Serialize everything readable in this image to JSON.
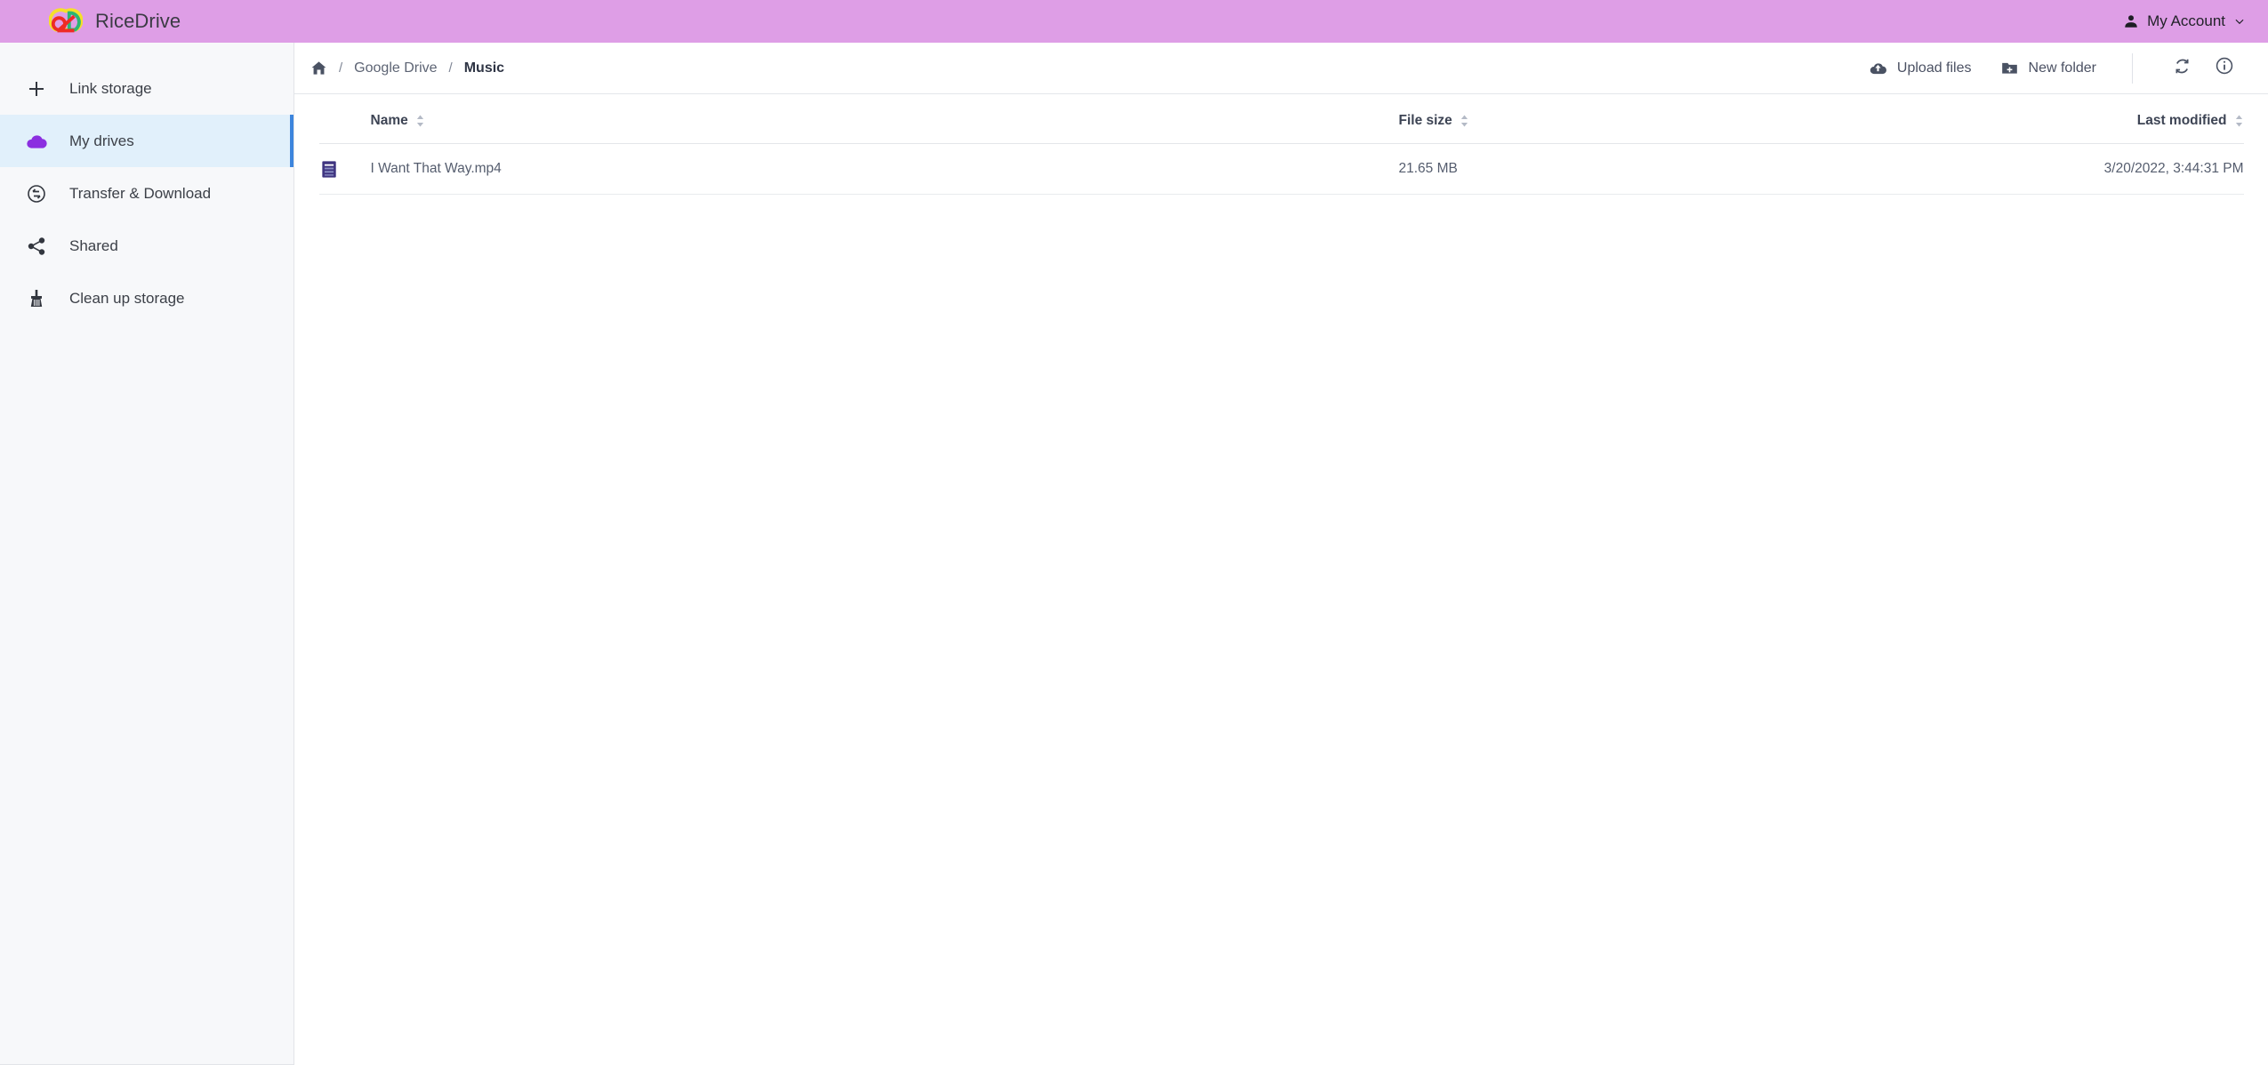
{
  "header": {
    "brand_name": "RiceDrive",
    "logo_icon": "ricedrive-logo-icon",
    "account_label": "My Account",
    "account_icon": "person-icon",
    "caret_icon": "chevron-down-icon",
    "background_color": "#de9ee6"
  },
  "sidebar": {
    "background_color": "#f7f8fa",
    "active_background_color": "#e1f0fb",
    "active_accent_color": "#3d85dd",
    "items": [
      {
        "label": "Link storage",
        "icon": "plus-icon",
        "active": false
      },
      {
        "label": "My drives",
        "icon": "cloud-icon",
        "active": true
      },
      {
        "label": "Transfer & Download",
        "icon": "transfer-circle-icon",
        "active": false
      },
      {
        "label": "Shared",
        "icon": "share-icon",
        "active": false
      },
      {
        "label": "Clean up storage",
        "icon": "broom-icon",
        "active": false
      }
    ]
  },
  "toolbar": {
    "breadcrumb": {
      "home_icon": "home-icon",
      "separator": "/",
      "items": [
        {
          "label": "Google Drive",
          "current": false
        },
        {
          "label": "Music",
          "current": true
        }
      ]
    },
    "actions": {
      "upload_label": "Upload files",
      "upload_icon": "cloud-upload-icon",
      "new_folder_label": "New folder",
      "new_folder_icon": "folder-plus-icon",
      "refresh_icon": "refresh-icon",
      "info_icon": "info-circle-icon"
    }
  },
  "file_table": {
    "columns": [
      {
        "key": "name",
        "label": "Name",
        "sortable": true
      },
      {
        "key": "size",
        "label": "File size",
        "sortable": true
      },
      {
        "key": "date",
        "label": "Last modified",
        "sortable": true
      }
    ],
    "sort_icon": "sort-updown-icon",
    "rows": [
      {
        "icon": "file-document-icon",
        "name": "I Want That Way.mp4",
        "size": "21.65 MB",
        "modified": "3/20/2022, 3:44:31 PM"
      }
    ]
  }
}
